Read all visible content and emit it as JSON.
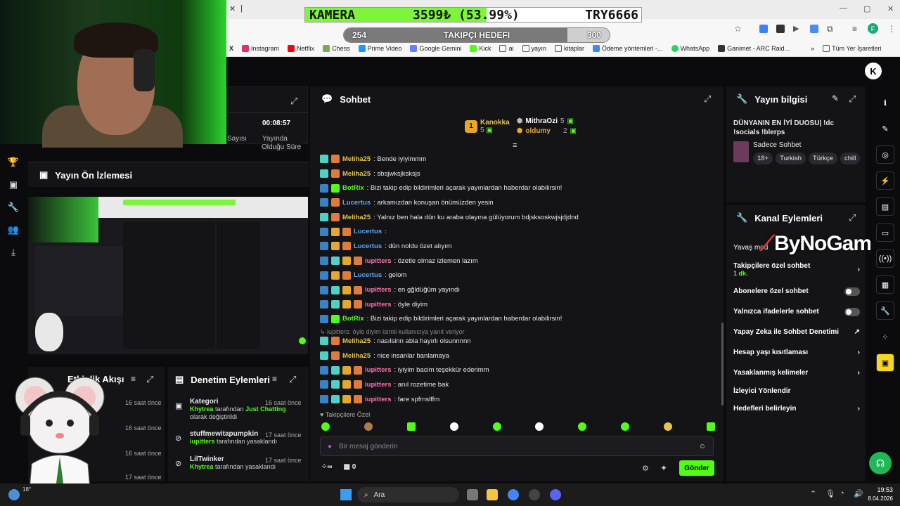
{
  "overlay": {
    "kamera_label": "KAMERA",
    "kamera_value": "3599₺ (53.99%)",
    "kamera_progress": 0.5399,
    "kamera_currency": "TRY6666",
    "takip_label": "TAKIPÇI HEDEFI",
    "takip_start": "254",
    "takip_end": "300",
    "takip_progress": 0.84
  },
  "bookmarks": [
    "Instagram",
    "Netflix",
    "Chess",
    "Prime Video",
    "Google Gemini",
    "Kick",
    "ai",
    "yayın",
    "kitaplar",
    "Ödeme yöntemleri -...",
    "WhatsApp",
    "Ganimet - ARC Raid..."
  ],
  "bookmarks_all": "Tüm Yer İşaretleri",
  "stats": {
    "time": "00:08:57",
    "label1": "Yayında",
    "label2": "Olduğu Süre",
    "sayisi": "Sayısı"
  },
  "preview": {
    "title": "Yayın Ön İzlemesi"
  },
  "chat": {
    "title": "Sohbet",
    "top": [
      {
        "rank": "1",
        "name": "Kanokka",
        "count": "5"
      },
      {
        "name": "MithraOzi",
        "count": "5"
      },
      {
        "name": "oldumy",
        "count": "2"
      }
    ],
    "messages": [
      {
        "user": "Meliha25",
        "text": ": Bende iyiyimmm",
        "color": "#e6c34a",
        "badges": [
          "#4fd1c5",
          "#e07b39"
        ]
      },
      {
        "user": "Meliha25",
        "text": ": sbsjwksjksksjs",
        "color": "#e6c34a",
        "badges": [
          "#4fd1c5",
          "#e07b39"
        ]
      },
      {
        "user": "BotRix",
        "text": ": Bizi takip edip bildirimleri açarak yayınlardan haberdar olabilirsin!",
        "color": "#53fc18",
        "badges": [
          "#3b82c4",
          "#53fc18"
        ]
      },
      {
        "user": "Lucertus",
        "text": ": arkamızdan konuşan önümüzden yesin",
        "color": "#5aa9ff",
        "badges": [
          "#3b82c4",
          "#e07b39"
        ]
      },
      {
        "user": "Meliha25",
        "text": ": Yalnız ben hala dün ku araba olayına gülüyorum bdjsksoskwjsjdjdnd",
        "color": "#e6c34a",
        "badges": [
          "#4fd1c5",
          "#e07b39"
        ]
      },
      {
        "user": "Lucertus",
        "text": ": ",
        "color": "#5aa9ff",
        "badges": [
          "#3b82c4",
          "#e6a72a",
          "#e07b39"
        ]
      },
      {
        "user": "Lucertus",
        "text": ": dün noldu özet alıyım",
        "color": "#5aa9ff",
        "badges": [
          "#3b82c4",
          "#e6a72a",
          "#e07b39"
        ]
      },
      {
        "user": "iupitters",
        "text": ": özetle olmaz izlemen lazım",
        "color": "#ff6fae",
        "badges": [
          "#3b82c4",
          "#4fd1c5",
          "#e6a72a",
          "#e07b39"
        ]
      },
      {
        "user": "Lucertus",
        "text": ": gelom",
        "color": "#5aa9ff",
        "badges": [
          "#3b82c4",
          "#e6a72a",
          "#e07b39"
        ]
      },
      {
        "user": "iupitters",
        "text": ": en gğldüğüm yayındı",
        "color": "#ff6fae",
        "badges": [
          "#3b82c4",
          "#4fd1c5",
          "#e6a72a",
          "#e07b39"
        ]
      },
      {
        "user": "iupitters",
        "text": ": öyle diyim",
        "color": "#ff6fae",
        "badges": [
          "#3b82c4",
          "#4fd1c5",
          "#e6a72a",
          "#e07b39"
        ]
      },
      {
        "user": "BotRix",
        "text": ": Bizi takip edip bildirimleri açarak yayınlardan haberdar olabilirsin!",
        "color": "#53fc18",
        "badges": [
          "#3b82c4",
          "#53fc18"
        ]
      }
    ],
    "reply_note": "iupitters: öyle diyim isimli kullanıcıya yanıt veriyor",
    "messages2": [
      {
        "user": "Meliha25",
        "text": ": nasılsinn abla hayırlı olsunnnnn",
        "color": "#e6c34a",
        "badges": [
          "#4fd1c5",
          "#e07b39"
        ]
      },
      {
        "user": "Meliha25",
        "text": ": nice insanlar banlamaya",
        "color": "#e6c34a",
        "badges": [
          "#4fd1c5",
          "#e07b39"
        ]
      },
      {
        "user": "iupitters",
        "text": ": iyiyim bacim teşekkür ederimm",
        "color": "#ff6fae",
        "badges": [
          "#3b82c4",
          "#4fd1c5",
          "#e6a72a",
          "#e07b39"
        ]
      },
      {
        "user": "iupitters",
        "text": ": anıl rozetime bak",
        "color": "#ff6fae",
        "badges": [
          "#3b82c4",
          "#4fd1c5",
          "#e6a72a",
          "#e07b39"
        ]
      },
      {
        "user": "iupitters",
        "text": ": fare spfmslffm",
        "color": "#ff6fae",
        "badges": [
          "#3b82c4",
          "#4fd1c5",
          "#e6a72a",
          "#e07b39"
        ]
      }
    ],
    "followers_only": "Takipçilere Özel",
    "input_placeholder": "Bir mesaj gönderin",
    "points": "0",
    "send": "Gönder"
  },
  "info": {
    "title": "Yayın bilgisi",
    "stream_title": "DÜNYANIN EN İYİ DUOSU| !dc !socials !blerps",
    "category": "Sadece Sohbet",
    "tags": [
      "18+",
      "Turkish",
      "Türkçe",
      "chill"
    ]
  },
  "kanal": {
    "title": "Kanal Eylemleri",
    "watermark": "ByNoGame",
    "slow": "Yavaş mod",
    "followers": "Takipçilere özel sohbet",
    "followers_sub": "1 dk.",
    "subs": "Abonelere özel sohbet",
    "emotes": "Yalnızca ifadelerle sohbet",
    "ai": "Yapay Zeka ile Sohbet Denetimi",
    "age": "Hesap yaşı kısıtlaması",
    "banned": "Yasaklanmış kelimeler",
    "redirect": "İzleyici Yönlendir",
    "goals": "Hedefleri belirleyin"
  },
  "activity": {
    "title": "Etkinlik Akışı",
    "times": [
      "16 saat önce",
      "16 saat önce",
      "16 saat önce",
      "17 saat önce"
    ]
  },
  "moderation": {
    "title": "Denetim Eylemleri",
    "items": [
      {
        "head": "Kategori",
        "time": "16 saat önce",
        "who": "Khytrea",
        "mid": " tarafından ",
        "hl": "Just Chatting",
        "tail": " olarak değiştirildi"
      },
      {
        "head": "stuffmewitapumpkin",
        "time": "17 saat önce",
        "who": "iupitters",
        "mid": " tarafından yasaklandı",
        "hl": "",
        "tail": ""
      },
      {
        "head": "LilTwinker",
        "time": "17 saat önce",
        "who": "Khytrea",
        "mid": " tarafından yasaklandı",
        "hl": "",
        "tail": ""
      }
    ]
  },
  "taskbar": {
    "search": "Ara",
    "time": "19:53",
    "date": "8.04.2026",
    "weather": "18°"
  },
  "colors": {
    "accent": "#53fc18",
    "bg": "#0b0b0d",
    "panel": "#141417"
  }
}
